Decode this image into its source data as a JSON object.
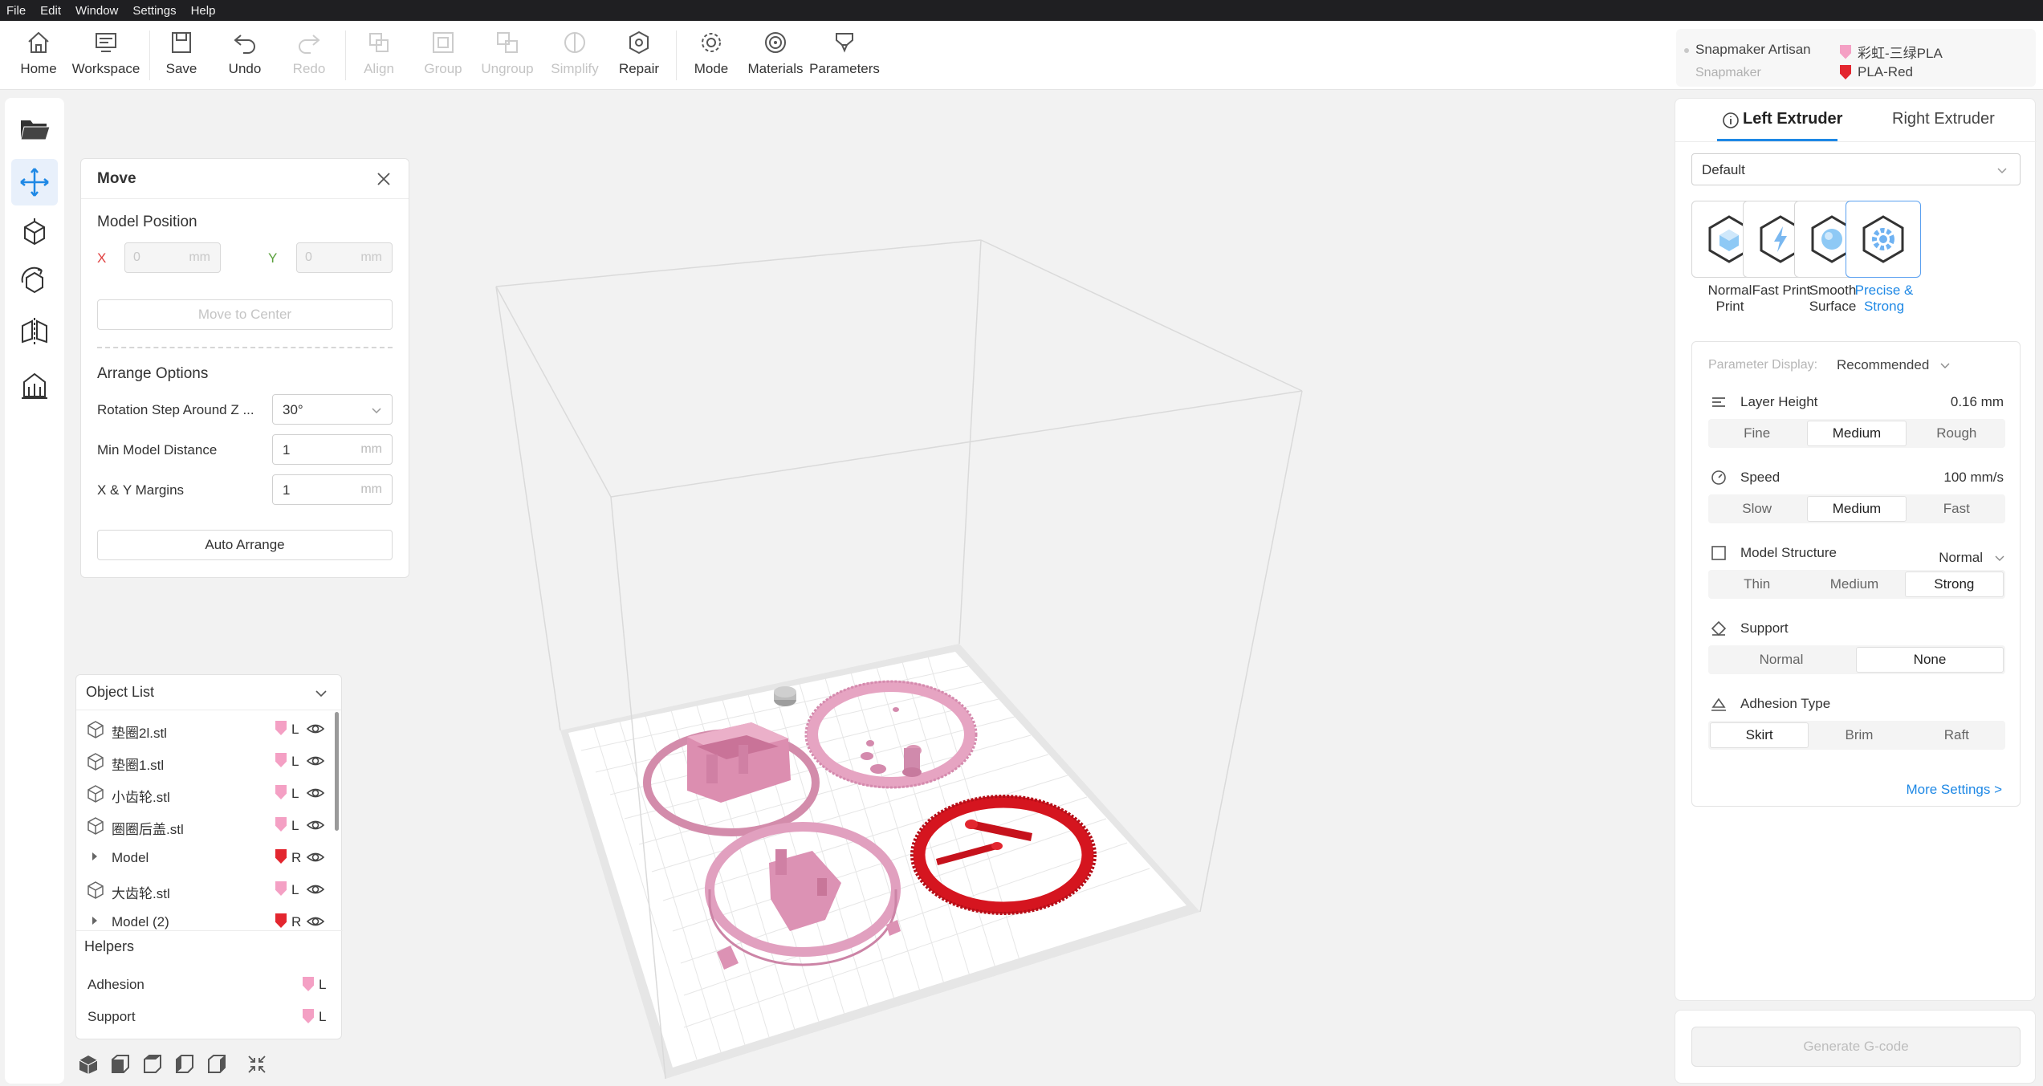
{
  "menubar": {
    "items": [
      "File",
      "Edit",
      "Window",
      "Settings",
      "Help"
    ]
  },
  "toolbar": {
    "home": "Home",
    "workspace": "Workspace",
    "save": "Save",
    "undo": "Undo",
    "redo": "Redo",
    "align": "Align",
    "group": "Group",
    "ungroup": "Ungroup",
    "simplify": "Simplify",
    "repair": "Repair",
    "mode": "Mode",
    "materials": "Materials",
    "parameters": "Parameters"
  },
  "machine": {
    "name": "Snapmaker Artisan",
    "brand": "Snapmaker",
    "materials": [
      {
        "label": "彩虹-三绿PLA",
        "color": "#f4a0c4"
      },
      {
        "label": "PLA-Red",
        "color": "#e3262f"
      }
    ]
  },
  "left_strip": {
    "icons": [
      "open-folder-icon",
      "move-icon",
      "scale-icon",
      "rotate-icon",
      "mirror-icon",
      "support-icon"
    ]
  },
  "move_panel": {
    "title": "Move",
    "position_title": "Model Position",
    "x_label": "X",
    "y_label": "Y",
    "x_value": "0",
    "y_value": "0",
    "unit": "mm",
    "center_btn": "Move to Center",
    "arrange_title": "Arrange Options",
    "rotation_label": "Rotation Step Around Z ...",
    "rotation_value": "30°",
    "distance_label": "Min Model Distance",
    "distance_value": "1",
    "margin_label": "X & Y Margins",
    "margin_value": "1",
    "arrange_btn": "Auto Arrange"
  },
  "object_list": {
    "title": "Object List",
    "items": [
      {
        "name": "垫圈2l.stl",
        "ext": "L",
        "color": "#f4a0c4",
        "group": false
      },
      {
        "name": "垫圈1.stl",
        "ext": "L",
        "color": "#f4a0c4",
        "group": false
      },
      {
        "name": "小齿轮.stl",
        "ext": "L",
        "color": "#f4a0c4",
        "group": false
      },
      {
        "name": "圈圈后盖.stl",
        "ext": "L",
        "color": "#f4a0c4",
        "group": false
      },
      {
        "name": "Model",
        "ext": "R",
        "color": "#e3262f",
        "group": true
      },
      {
        "name": "大齿轮.stl",
        "ext": "L",
        "color": "#f4a0c4",
        "group": false
      },
      {
        "name": "Model (2)",
        "ext": "R",
        "color": "#e3262f",
        "group": true
      }
    ],
    "helpers_title": "Helpers",
    "helpers": [
      {
        "name": "Adhesion",
        "ext": "L",
        "color": "#f4a0c4"
      },
      {
        "name": "Support",
        "ext": "L",
        "color": "#f4a0c4"
      }
    ]
  },
  "right_panel": {
    "tab_left": "Left Extruder",
    "tab_right": "Right Extruder",
    "profile": "Default",
    "presets": [
      {
        "label": "Normal\nPrint",
        "active": false
      },
      {
        "label": "Fast Print",
        "active": false
      },
      {
        "label": "Smooth\nSurface",
        "active": false
      },
      {
        "label": "Precise &\nStrong",
        "active": true
      }
    ],
    "param_display_label": "Parameter Display:",
    "param_display_value": "Recommended",
    "layer_height": {
      "title": "Layer Height",
      "value": "0.16 mm",
      "options": [
        "Fine",
        "Medium",
        "Rough"
      ],
      "selected": 1
    },
    "speed": {
      "title": "Speed",
      "value": "100 mm/s",
      "options": [
        "Slow",
        "Medium",
        "Fast"
      ],
      "selected": 1
    },
    "structure": {
      "title": "Model Structure",
      "value": "Normal",
      "options": [
        "Thin",
        "Medium",
        "Strong"
      ],
      "selected": 2
    },
    "support": {
      "title": "Support",
      "options": [
        "Normal",
        "None"
      ],
      "selected": 1
    },
    "adhesion": {
      "title": "Adhesion Type",
      "options": [
        "Skirt",
        "Brim",
        "Raft"
      ],
      "selected": 0
    },
    "more_settings": "More Settings >",
    "generate": "Generate G-code"
  }
}
